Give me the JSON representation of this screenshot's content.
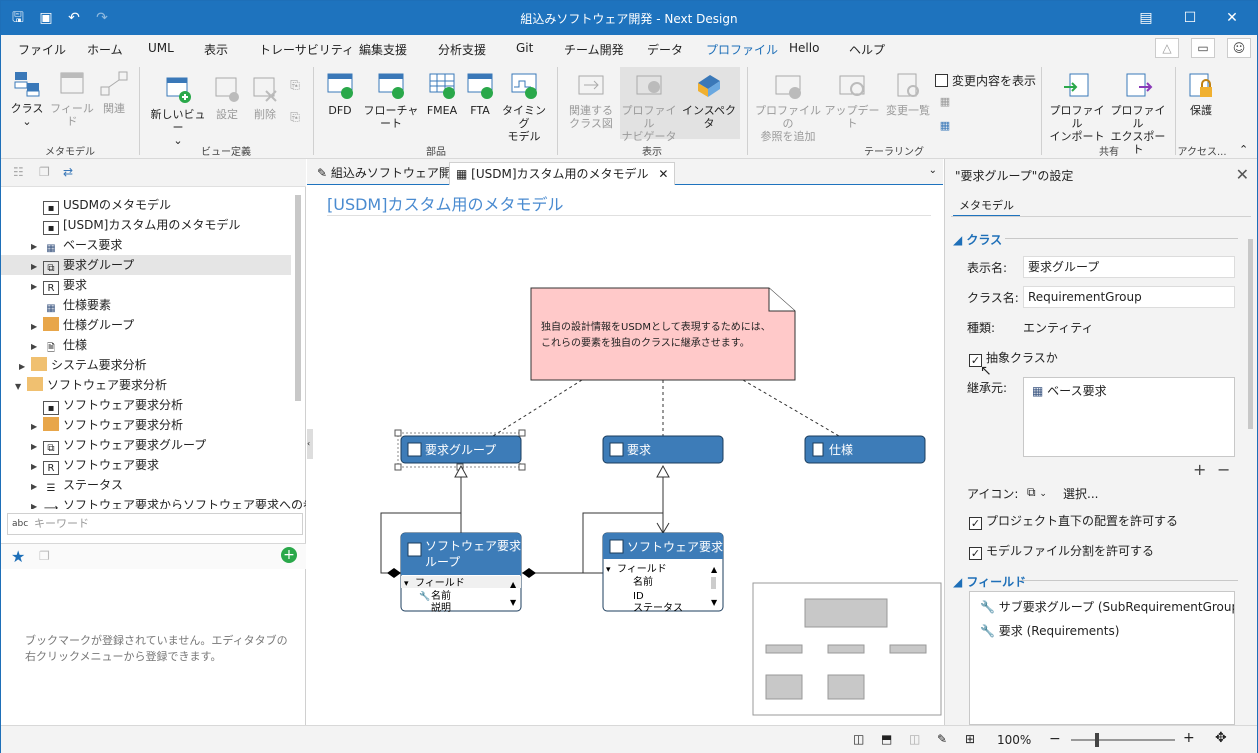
{
  "window": {
    "title": "組込みソフトウェア開発 - Next Design"
  },
  "menu": [
    "ファイル",
    "ホーム",
    "UML",
    "表示",
    "トレーサビリティ",
    "編集支援",
    "分析支援",
    "Git",
    "チーム開発",
    "データ",
    "プロファイル",
    "Hello",
    "ヘルプ"
  ],
  "ribbon": {
    "class": "クラス",
    "field": "フィールド",
    "relation": "関連",
    "group_metamodel": "メタモデル",
    "new_view": "新しいビュー",
    "settings": "設定",
    "delete": "削除",
    "group_viewdef": "ビュー定義",
    "dfd": "DFD",
    "flowchart": "フローチャート",
    "fmea": "FMEA",
    "fta": "FTA",
    "timing1": "タイミング",
    "timing2": "モデル",
    "group_parts": "部品",
    "related1": "関連する",
    "related2": "クラス図",
    "pnav1": "プロファイル",
    "pnav2": "ナビゲータ",
    "inspector": "インスペクタ",
    "group_view": "表示",
    "addref1": "プロファイルの",
    "addref2": "参照を追加",
    "update": "アップデート",
    "changelist": "変更一覧",
    "show_changes": "変更内容を表示",
    "group_tailoring": "テーラリング",
    "pimport1": "プロファイル",
    "pimport2": "インポート",
    "pexport1": "プロファイル",
    "pexport2": "エクスポート",
    "group_share": "共有",
    "protect": "保護",
    "group_access": "アクセス..."
  },
  "tree": [
    {
      "label": "USDMのメタモデル"
    },
    {
      "label": "[USDM]カスタム用のメタモデル"
    },
    {
      "label": "ベース要求"
    },
    {
      "label": "要求グループ"
    },
    {
      "label": "要求"
    },
    {
      "label": "仕様要素"
    },
    {
      "label": "仕様グループ"
    },
    {
      "label": "仕様"
    },
    {
      "label": "システム要求分析"
    },
    {
      "label": "ソフトウェア要求分析"
    },
    {
      "label": "ソフトウェア要求分析"
    },
    {
      "label": "ソフトウェア要求分析"
    },
    {
      "label": "ソフトウェア要求グループ"
    },
    {
      "label": "ソフトウェア要求"
    },
    {
      "label": "ステータス"
    },
    {
      "label": "ソフトウェア要求からソフトウェア要求への参照"
    }
  ],
  "keyword_placeholder": "キーワード",
  "bookmark_msg": "ブックマークが登録されていません。エディタタブの右クリックメニューから登録できます。",
  "tabs": {
    "t1": "組込みソフトウェア開発",
    "t2": "[USDM]カスタム用のメタモデル"
  },
  "diagram": {
    "title": "[USDM]カスタム用のメタモデル",
    "note1": "独自の設計情報をUSDMとして表現するためには、",
    "note2": "これらの要素を独自のクラスに継承させます。",
    "c1": "要求グループ",
    "c2": "要求",
    "c3": "仕様",
    "c4a": "ソフトウェア要求グ",
    "c4b": "ループ",
    "c5": "ソフトウェア要求",
    "f_field": "フィールド",
    "f_name": "名前",
    "f_desc": "説明",
    "f_id": "ID",
    "f_status": "ステータス"
  },
  "props": {
    "title": "\"要求グループ\"の設定",
    "tab": "メタモデル",
    "section_class": "クラス",
    "display_name_label": "表示名:",
    "display_name": "要求グループ",
    "class_name_label": "クラス名:",
    "class_name": "RequirementGroup",
    "kind_label": "種類:",
    "kind": "エンティティ",
    "abstract": "抽象クラスか",
    "inherit_label": "継承元:",
    "inherit_value": "ベース要求",
    "icon_label": "アイコン:",
    "select": "選択...",
    "allow_root": "プロジェクト直下の配置を許可する",
    "allow_split": "モデルファイル分割を許可する",
    "section_fields": "フィールド",
    "field1": "サブ要求グループ (SubRequirementGroups",
    "field2": "要求 (Requirements)"
  },
  "status": {
    "zoom": "100%"
  }
}
